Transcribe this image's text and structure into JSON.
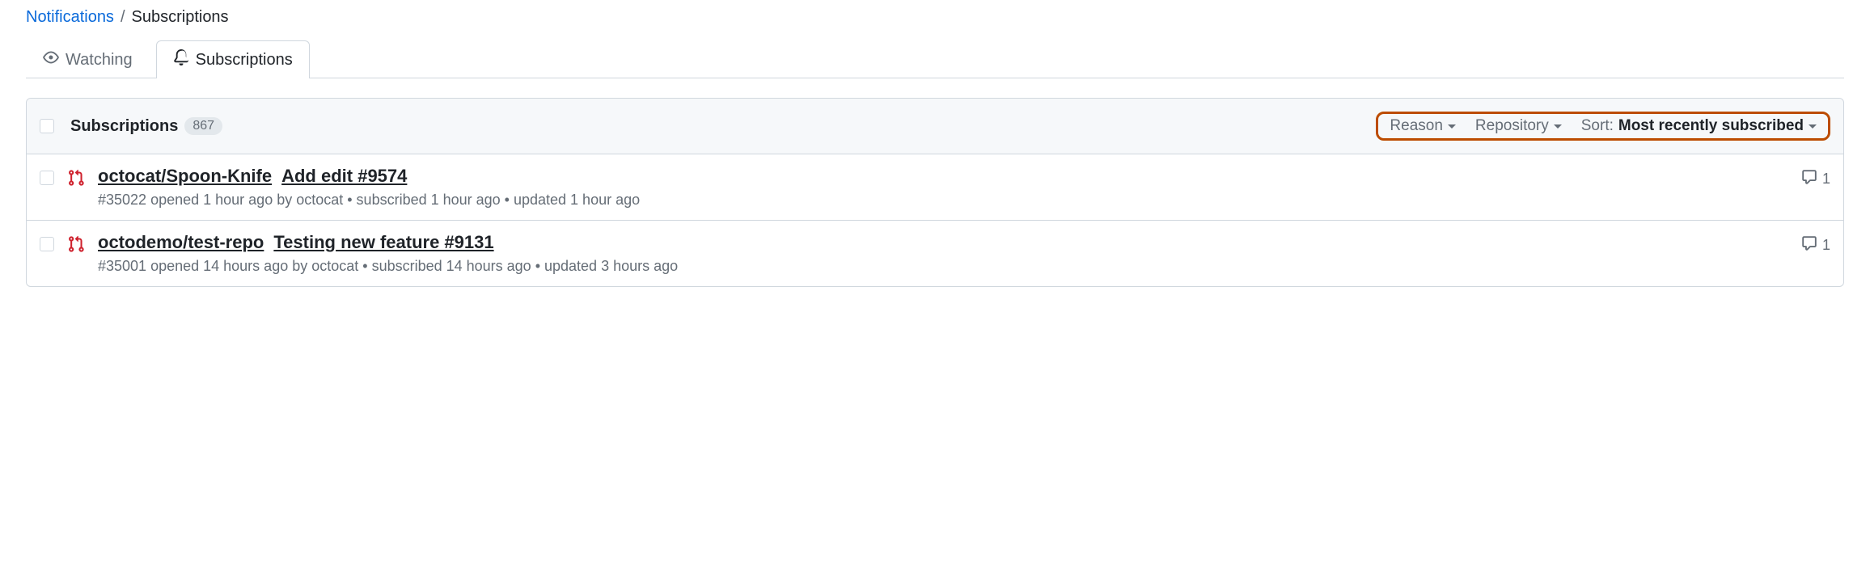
{
  "breadcrumb": {
    "parent": "Notifications",
    "current": "Subscriptions"
  },
  "tabs": {
    "watching": "Watching",
    "subscriptions": "Subscriptions"
  },
  "header": {
    "title": "Subscriptions",
    "count": "867"
  },
  "filters": {
    "reason": "Reason",
    "repository": "Repository",
    "sort_label": "Sort:",
    "sort_value": "Most recently subscribed"
  },
  "rows": [
    {
      "repo": "octocat/Spoon-Knife",
      "title": "Add edit #9574",
      "meta": "#35022 opened 1 hour ago by octocat • subscribed 1 hour ago • updated 1 hour ago",
      "comments": "1"
    },
    {
      "repo": "octodemo/test-repo",
      "title": "Testing new feature #9131",
      "meta": "#35001 opened 14 hours ago by octocat • subscribed 14 hours ago • updated 3 hours ago",
      "comments": "1"
    }
  ]
}
